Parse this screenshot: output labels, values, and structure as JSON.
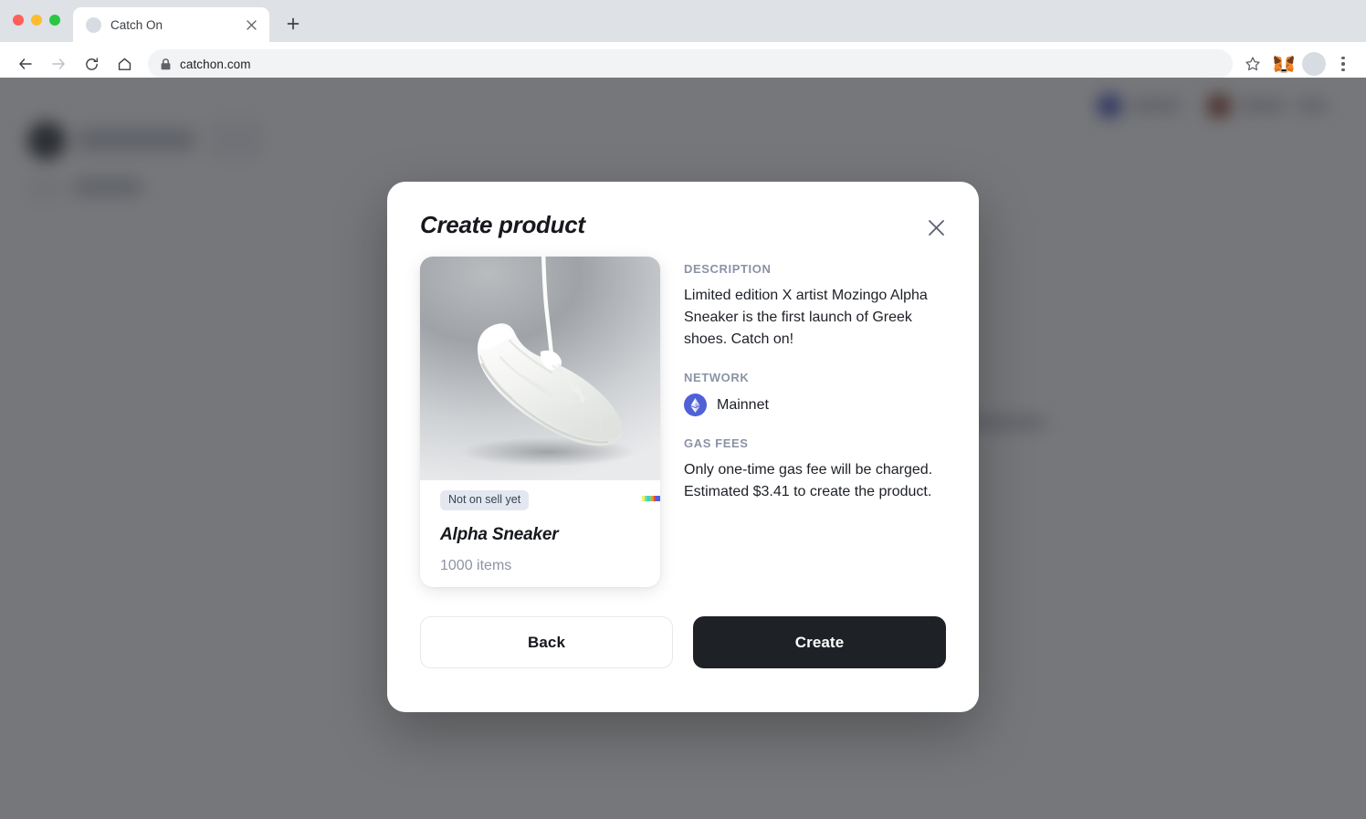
{
  "browser": {
    "tab": {
      "title": "Catch On",
      "favicon_icon": "generic-page-favicon",
      "close_icon": "close-icon"
    },
    "new_tab_icon": "plus-icon",
    "nav": {
      "back_icon": "arrow-left-icon",
      "forward_icon": "arrow-right-icon",
      "reload_icon": "reload-icon",
      "home_icon": "home-icon"
    },
    "omnibox": {
      "lock_icon": "lock-icon",
      "url": "catchon.com"
    },
    "toolbar_right": {
      "bookmark_icon": "star-icon",
      "extension_icon": "metamask-fox-icon",
      "profile_icon": "avatar-icon",
      "menu_icon": "three-dot-menu-icon"
    },
    "window_controls": {
      "close": "close-window-dot",
      "minimize": "minimize-window-dot",
      "maximize": "maximize-window-dot"
    }
  },
  "modal": {
    "title": "Create product",
    "close_icon": "close-icon",
    "product_card": {
      "image_alt": "white-sneaker-hanging-by-lace",
      "badge": "Not on sell yet",
      "accent_bar_icon": "rainbow-accent-bar",
      "name": "Alpha Sneaker",
      "count": "1000 items"
    },
    "sections": [
      {
        "label": "DESCRIPTION",
        "text": "Limited edition X artist Mozingo Alpha Sneaker is the first launch of Greek shoes. Catch on!"
      },
      {
        "label": "NETWORK",
        "network_icon": "ethereum-icon",
        "network_name": "Mainnet"
      },
      {
        "label": "GAS FEES",
        "text": "Only one-time gas fee will be charged. Estimated $3.41 to create the product."
      }
    ],
    "buttons": {
      "back": "Back",
      "create": "Create"
    }
  },
  "colors": {
    "accent_dark": "#1e2126",
    "muted_label": "#8a93a6",
    "badge_bg": "#e3e8f0",
    "network_blue": "#5060d6",
    "overlay": "rgba(34,36,41,0.62)"
  }
}
